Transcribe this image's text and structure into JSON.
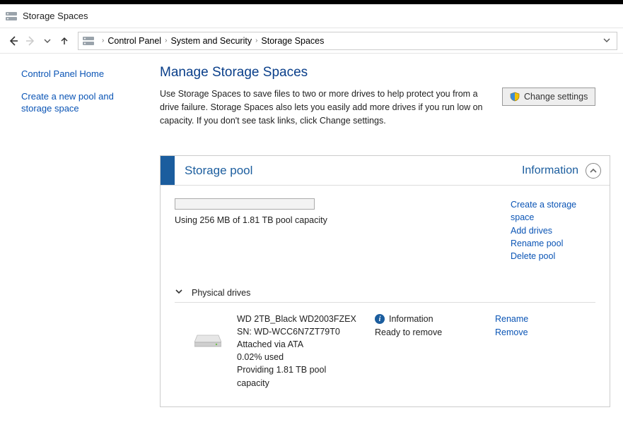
{
  "window": {
    "title": "Storage Spaces"
  },
  "breadcrumb": {
    "items": [
      "Control Panel",
      "System and Security",
      "Storage Spaces"
    ]
  },
  "sidebar": {
    "home": "Control Panel Home",
    "create": "Create a new pool and storage space"
  },
  "page": {
    "title": "Manage Storage Spaces",
    "intro": "Use Storage Spaces to save files to two or more drives to help protect you from a drive failure. Storage Spaces also lets you easily add more drives if you run low on capacity. If you don't see task links, click Change settings.",
    "change_settings": "Change settings"
  },
  "panel": {
    "title": "Storage pool",
    "info_label": "Information",
    "usage_text": "Using 256 MB of 1.81 TB pool capacity",
    "links": {
      "create_space": "Create a storage space",
      "add_drives": "Add drives",
      "rename_pool": "Rename pool",
      "delete_pool": "Delete pool"
    },
    "physical_label": "Physical drives",
    "drive": {
      "model": "WD 2TB_Black WD2003FZEX",
      "serial": "SN: WD-WCC6N7ZT79T0",
      "attached": "Attached via ATA",
      "used": "0.02% used",
      "providing": "Providing 1.81 TB pool capacity",
      "status_info": "Information",
      "status_ready": "Ready to remove",
      "rename": "Rename",
      "remove": "Remove"
    }
  }
}
